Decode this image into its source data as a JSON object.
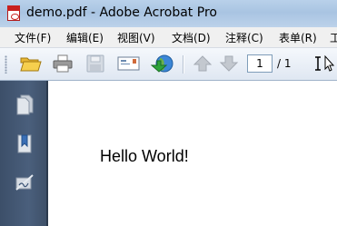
{
  "window": {
    "title": "demo.pdf - Adobe Acrobat Pro",
    "app_icon": "acrobat-pdf-icon"
  },
  "menu": {
    "items": [
      {
        "label": "文件(F)"
      },
      {
        "label": "编辑(E)"
      },
      {
        "label": "视图(V)"
      },
      {
        "label": "文档(D)"
      },
      {
        "label": "注释(C)"
      },
      {
        "label": "表单(R)"
      },
      {
        "label": "工"
      }
    ]
  },
  "toolbar": {
    "buttons": [
      "open-folder-icon",
      "print-icon",
      "save-icon",
      "email-icon",
      "collaborate-globe-icon",
      "previous-page-icon",
      "next-page-icon",
      "select-text-icon"
    ],
    "page_current": "1",
    "page_total": "/ 1"
  },
  "navpane": {
    "buttons": [
      "pages-icon",
      "bookmarks-icon",
      "signatures-icon"
    ]
  },
  "document": {
    "text": "Hello World!"
  }
}
